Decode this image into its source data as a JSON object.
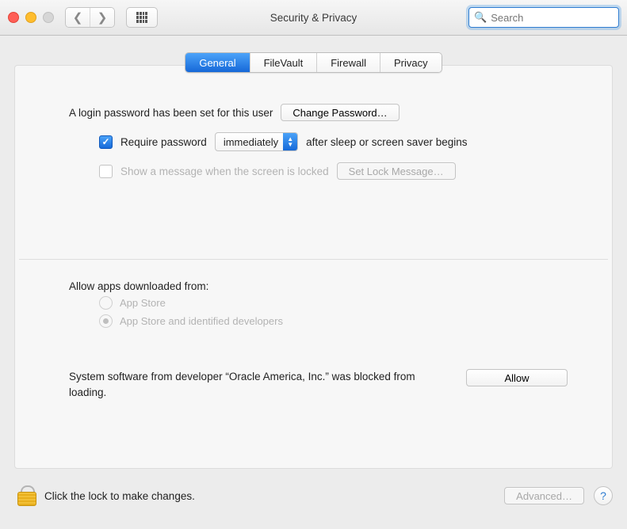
{
  "window": {
    "title": "Security & Privacy",
    "search_placeholder": "Search"
  },
  "tabs": {
    "general": "General",
    "filevault": "FileVault",
    "firewall": "Firewall",
    "privacy": "Privacy"
  },
  "login": {
    "password_set_text": "A login password has been set for this user",
    "change_password_btn": "Change Password…",
    "require_password_label": "Require password",
    "require_password_delay": "immediately",
    "require_password_suffix": "after sleep or screen saver begins",
    "show_message_label": "Show a message when the screen is locked",
    "set_lock_message_btn": "Set Lock Message…"
  },
  "apps": {
    "heading": "Allow apps downloaded from:",
    "opt_app_store": "App Store",
    "opt_identified": "App Store and identified developers"
  },
  "blocked": {
    "text": "System software from developer “Oracle America, Inc.” was blocked from loading.",
    "allow_btn": "Allow"
  },
  "footer": {
    "lock_text": "Click the lock to make changes.",
    "advanced_btn": "Advanced…"
  }
}
